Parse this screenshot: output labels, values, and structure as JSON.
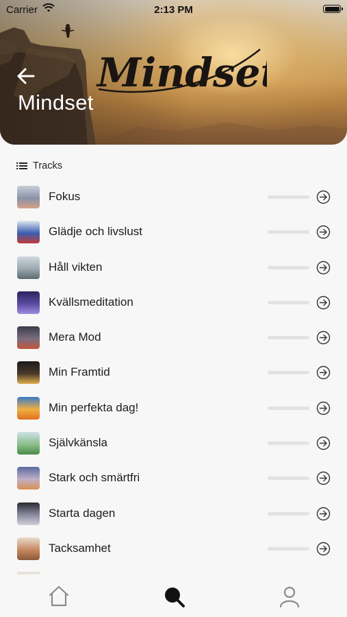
{
  "status_bar": {
    "carrier": "Carrier",
    "time": "2:13 PM"
  },
  "header": {
    "title": "Mindset",
    "banner_script": "Mindset"
  },
  "section": {
    "label": "Tracks",
    "icon": "list-icon"
  },
  "tracks": [
    {
      "label": "Fokus",
      "progress": 0,
      "thumb_colors": [
        "#c9cdd8",
        "#8a93a8",
        "#d4a086"
      ]
    },
    {
      "label": "Glädje och livslust",
      "progress": 0,
      "thumb_colors": [
        "#dfe6ee",
        "#3a5fb0",
        "#c23a3a"
      ]
    },
    {
      "label": "Håll vikten",
      "progress": 0,
      "thumb_colors": [
        "#cfd8de",
        "#9aa9b0",
        "#5d6b70"
      ]
    },
    {
      "label": "Kvällsmeditation",
      "progress": 0,
      "thumb_colors": [
        "#2b2560",
        "#5a4aa0",
        "#9d8de0"
      ]
    },
    {
      "label": "Mera Mod",
      "progress": 0,
      "thumb_colors": [
        "#3a3c4a",
        "#7a6e7e",
        "#c2553a"
      ]
    },
    {
      "label": "Min Framtid",
      "progress": 0,
      "thumb_colors": [
        "#1a1a1a",
        "#4a3a2a",
        "#e0b050"
      ]
    },
    {
      "label": "Min perfekta dag!",
      "progress": 0,
      "thumb_colors": [
        "#3a7ac8",
        "#f0b040",
        "#e07020"
      ]
    },
    {
      "label": "Självkänsla",
      "progress": 0,
      "thumb_colors": [
        "#cfe0e8",
        "#8cbf8a",
        "#4a8a4a"
      ]
    },
    {
      "label": "Stark och smärtfri",
      "progress": 0,
      "thumb_colors": [
        "#5a6aa0",
        "#c0b0c8",
        "#d89050"
      ]
    },
    {
      "label": "Starta dagen",
      "progress": 0,
      "thumb_colors": [
        "#2a2a30",
        "#8a8aa0",
        "#d0d0d8"
      ]
    },
    {
      "label": "Tacksamhet",
      "progress": 0,
      "thumb_colors": [
        "#e8dccc",
        "#c88860",
        "#8a5a3a"
      ]
    }
  ],
  "tabbar": [
    {
      "name": "home",
      "icon": "home-icon",
      "active": false
    },
    {
      "name": "search",
      "icon": "search-icon",
      "active": true
    },
    {
      "name": "profile",
      "icon": "profile-icon",
      "active": false
    }
  ],
  "colors": {
    "accent": "#1c1c1c",
    "inactive_icon": "#8a8a8a",
    "background": "#f7f7f7",
    "progress_track": "#e2e2e2"
  }
}
